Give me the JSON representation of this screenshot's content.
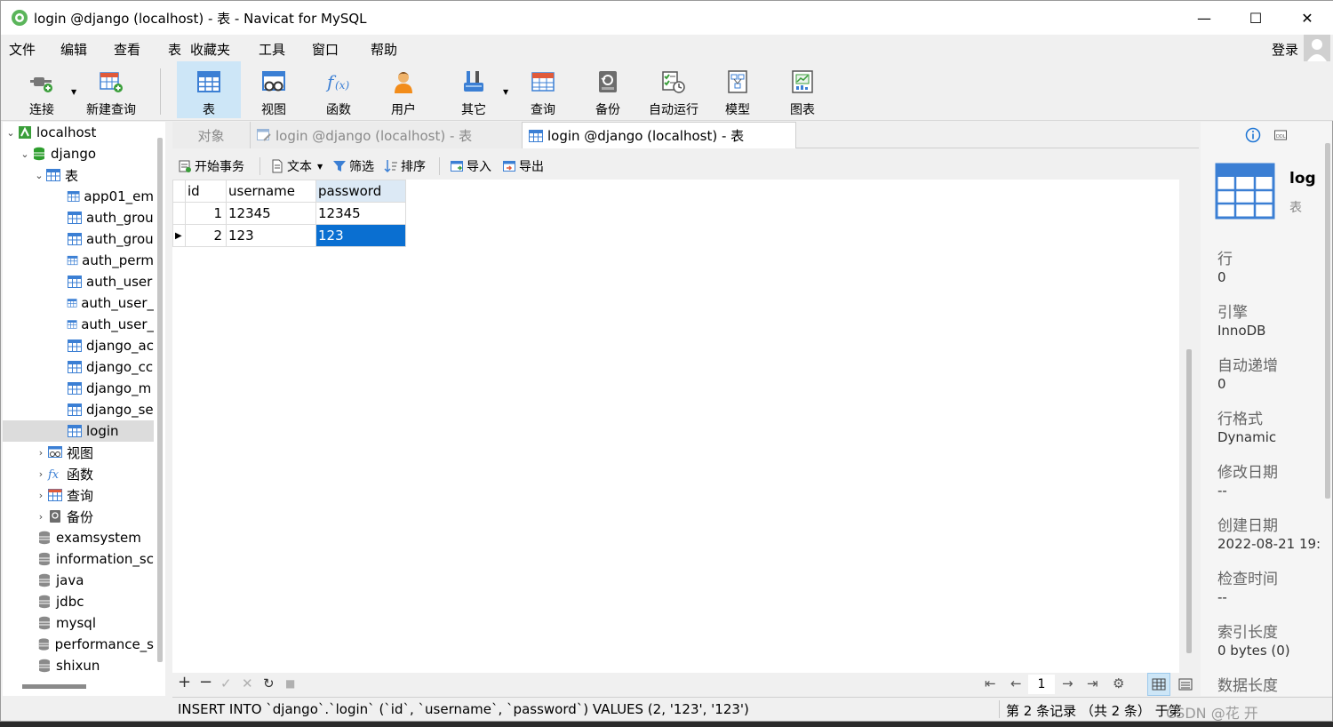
{
  "window": {
    "title": "login @django (localhost) - 表 - Navicat for MySQL",
    "minimize": "—",
    "maximize": "☐",
    "close": "✕"
  },
  "menu": {
    "items": [
      "文件",
      "编辑",
      "查看",
      "表",
      "收藏夹",
      "工具",
      "窗口",
      "帮助"
    ],
    "login": "登录"
  },
  "toolbar": {
    "buttons": [
      {
        "label": "连接",
        "icon": "connect-icon"
      },
      {
        "label": "新建查询",
        "icon": "new-query-icon"
      },
      {
        "label": "表",
        "icon": "table-icon",
        "active": true
      },
      {
        "label": "视图",
        "icon": "view-icon"
      },
      {
        "label": "函数",
        "icon": "function-icon"
      },
      {
        "label": "用户",
        "icon": "user-icon"
      },
      {
        "label": "其它",
        "icon": "other-icon"
      },
      {
        "label": "查询",
        "icon": "query-icon"
      },
      {
        "label": "备份",
        "icon": "backup-icon"
      },
      {
        "label": "自动运行",
        "icon": "auto-run-icon"
      },
      {
        "label": "模型",
        "icon": "model-icon"
      },
      {
        "label": "图表",
        "icon": "chart-icon"
      }
    ]
  },
  "tree": {
    "connection": "localhost",
    "database": "django",
    "tables_group": "表",
    "tables": [
      "app01_em",
      "auth_grou",
      "auth_grou",
      "auth_perm",
      "auth_user",
      "auth_user_",
      "auth_user_",
      "django_ac",
      "django_cc",
      "django_m",
      "django_se",
      "login"
    ],
    "groups": [
      {
        "label": "视图",
        "icon": "view-icon"
      },
      {
        "label": "函数",
        "icon": "function-icon"
      },
      {
        "label": "查询",
        "icon": "query-icon"
      },
      {
        "label": "备份",
        "icon": "backup-icon"
      }
    ],
    "databases": [
      "examsystem",
      "information_sc",
      "java",
      "jdbc",
      "mysql",
      "performance_s",
      "shixun"
    ]
  },
  "tabs": [
    {
      "label": "对象"
    },
    {
      "label": "login @django (localhost) - 表"
    },
    {
      "label": "login @django (localhost) - 表"
    }
  ],
  "subtoolbar": {
    "begin_transaction": "开始事务",
    "text": "文本",
    "filter": "筛选",
    "sort": "排序",
    "import": "导入",
    "export": "导出"
  },
  "grid": {
    "columns": [
      "id",
      "username",
      "password"
    ],
    "rows": [
      [
        "1",
        "12345",
        "12345"
      ],
      [
        "2",
        "123",
        "123"
      ]
    ],
    "current_row_marker": "▶"
  },
  "gridbar": {
    "add": "+",
    "remove": "−",
    "apply": "✓",
    "discard": "✕",
    "refresh": "↻",
    "stop": "■",
    "first": "⇤",
    "prev": "←",
    "page": "1",
    "next": "→",
    "last": "⇥",
    "settings": "⚙"
  },
  "status": {
    "sql": "INSERT INTO `django`.`login` (`id`, `username`, `password`) VALUES (2, '123', '123')",
    "record": "第 2 条记录 （共 2 条） 于第",
    "watermark": "CSDN @花 开 "
  },
  "info": {
    "name": "log",
    "type": "表",
    "fields": [
      {
        "label": "行",
        "value": "0"
      },
      {
        "label": "引擎",
        "value": "InnoDB"
      },
      {
        "label": "自动递增",
        "value": "0"
      },
      {
        "label": "行格式",
        "value": "Dynamic"
      },
      {
        "label": "修改日期",
        "value": "--"
      },
      {
        "label": "创建日期",
        "value": "2022-08-21 19:"
      },
      {
        "label": "检查时间",
        "value": "--"
      },
      {
        "label": "索引长度",
        "value": "0 bytes (0)"
      },
      {
        "label": "数据长度",
        "value": ""
      }
    ]
  },
  "colors": {
    "accent": "#0a6fd1",
    "active_toolbar": "#cde6f7",
    "database_green": "#2e9e2e",
    "table_blue": "#3b7fd4"
  }
}
